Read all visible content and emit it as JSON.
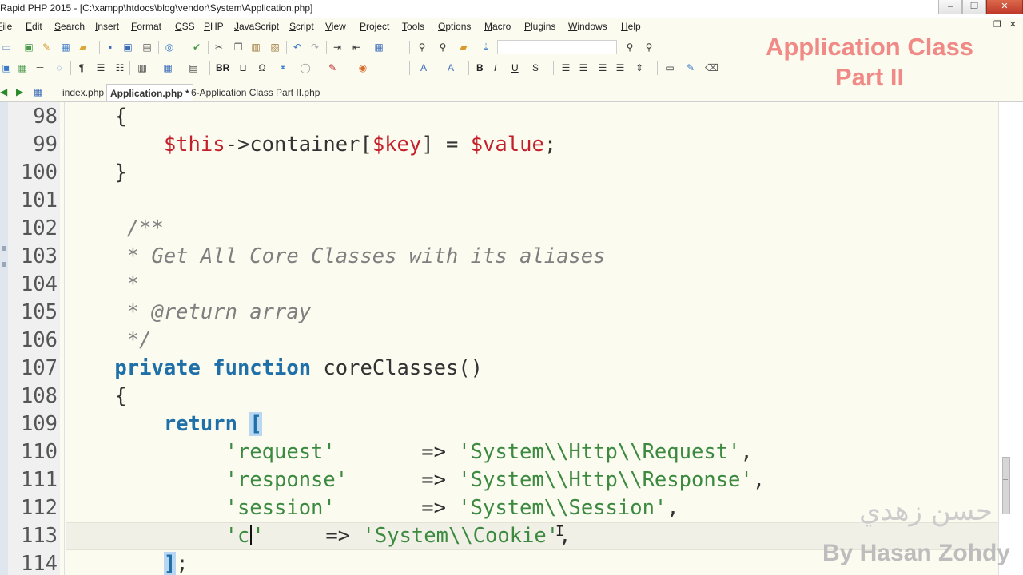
{
  "window": {
    "title": "Rapid PHP 2015 - [C:\\xampp\\htdocs\\blog\\vendor\\System\\Application.php]",
    "minimize": "–",
    "maximize": "❐",
    "close": "✕"
  },
  "menu": {
    "items": [
      "File",
      "Edit",
      "Search",
      "Insert",
      "Format",
      "CSS",
      "PHP",
      "JavaScript",
      "Script",
      "View",
      "Project",
      "Tools",
      "Options",
      "Macro",
      "Plugins",
      "Windows",
      "Help"
    ],
    "restore": "❐",
    "close": "✕"
  },
  "toolbar": {
    "bold": "B",
    "italic": "I",
    "underline": "U",
    "br": "BR"
  },
  "watermark": {
    "title_line1": "Application Class",
    "title_line2": "Part II",
    "author_ar": "حسن زهدي",
    "author_en": "By Hasan Zohdy"
  },
  "tabs": [
    {
      "label": "index.php",
      "active": false
    },
    {
      "label": "Application.php *",
      "active": true
    },
    {
      "label": "6-Application Class Part II.php",
      "active": false
    }
  ],
  "editor": {
    "lines": [
      {
        "n": "98",
        "tokens": [
          {
            "t": "pl",
            "v": "    {"
          }
        ]
      },
      {
        "n": "99",
        "tokens": [
          {
            "t": "pl",
            "v": "        "
          },
          {
            "t": "var",
            "v": "$this"
          },
          {
            "t": "op",
            "v": "->"
          },
          {
            "t": "pl",
            "v": "container["
          },
          {
            "t": "var",
            "v": "$key"
          },
          {
            "t": "pl",
            "v": "] = "
          },
          {
            "t": "var",
            "v": "$value"
          },
          {
            "t": "pl",
            "v": ";"
          }
        ]
      },
      {
        "n": "100",
        "tokens": [
          {
            "t": "pl",
            "v": "    }"
          }
        ]
      },
      {
        "n": "101",
        "tokens": []
      },
      {
        "n": "102",
        "tokens": [
          {
            "t": "cmt",
            "v": "     /**"
          }
        ]
      },
      {
        "n": "103",
        "tokens": [
          {
            "t": "cmt",
            "v": "     * Get All Core Classes with its aliases"
          }
        ]
      },
      {
        "n": "104",
        "tokens": [
          {
            "t": "cmt",
            "v": "     *"
          }
        ]
      },
      {
        "n": "105",
        "tokens": [
          {
            "t": "cmt",
            "v": "     * @return array"
          }
        ]
      },
      {
        "n": "106",
        "tokens": [
          {
            "t": "cmt",
            "v": "     */"
          }
        ]
      },
      {
        "n": "107",
        "tokens": [
          {
            "t": "kw",
            "v": "    private"
          },
          {
            "t": "pl",
            "v": " "
          },
          {
            "t": "kw",
            "v": "function"
          },
          {
            "t": "pl",
            "v": " coreClasses()"
          }
        ]
      },
      {
        "n": "108",
        "tokens": [
          {
            "t": "pl",
            "v": "    {"
          }
        ]
      },
      {
        "n": "109",
        "tokens": [
          {
            "t": "pl",
            "v": "        "
          },
          {
            "t": "kw",
            "v": "return"
          },
          {
            "t": "pl",
            "v": " "
          },
          {
            "t": "bracket",
            "v": "["
          }
        ]
      },
      {
        "n": "110",
        "tokens": [
          {
            "t": "pl",
            "v": "             "
          },
          {
            "t": "str",
            "v": "'request'"
          },
          {
            "t": "pl",
            "v": "       => "
          },
          {
            "t": "str",
            "v": "'System\\\\Http\\\\Request'"
          },
          {
            "t": "pl",
            "v": ","
          }
        ]
      },
      {
        "n": "111",
        "tokens": [
          {
            "t": "pl",
            "v": "             "
          },
          {
            "t": "str",
            "v": "'response'"
          },
          {
            "t": "pl",
            "v": "      => "
          },
          {
            "t": "str",
            "v": "'System\\\\Http\\\\Response'"
          },
          {
            "t": "pl",
            "v": ","
          }
        ]
      },
      {
        "n": "112",
        "tokens": [
          {
            "t": "pl",
            "v": "             "
          },
          {
            "t": "str",
            "v": "'session'"
          },
          {
            "t": "pl",
            "v": "       => "
          },
          {
            "t": "str",
            "v": "'System\\\\Session'"
          },
          {
            "t": "pl",
            "v": ","
          }
        ]
      },
      {
        "n": "113",
        "tokens": [
          {
            "t": "pl",
            "v": "             "
          },
          {
            "t": "str",
            "v": "'c"
          },
          {
            "t": "caret",
            "v": ""
          },
          {
            "t": "str",
            "v": "'"
          },
          {
            "t": "pl",
            "v": "     => "
          },
          {
            "t": "str",
            "v": "'System\\\\Cookie'"
          },
          {
            "t": "pl",
            "v": ","
          }
        ],
        "current": true
      },
      {
        "n": "114",
        "tokens": [
          {
            "t": "pl",
            "v": "        "
          },
          {
            "t": "bracket",
            "v": "]"
          },
          {
            "t": "pl",
            "v": ";"
          }
        ]
      }
    ]
  },
  "cursor": {
    "glyph": "I"
  }
}
